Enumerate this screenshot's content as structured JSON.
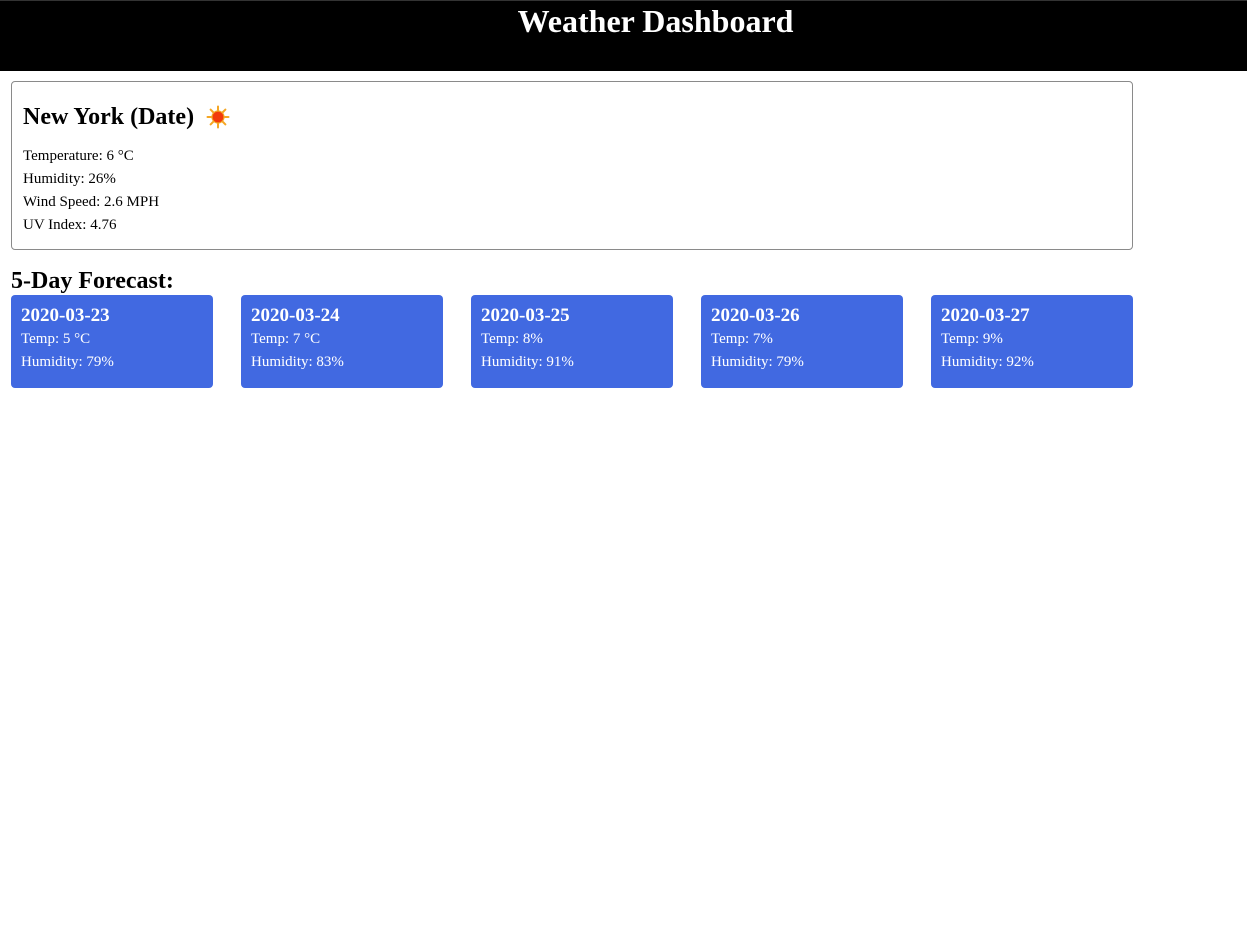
{
  "header": {
    "title": "Weather Dashboard"
  },
  "current": {
    "heading": "New York (Date)",
    "icon": "sun-icon",
    "temperature": "Temperature: 6 °C",
    "humidity": "Humidity: 26%",
    "wind_speed": "Wind Speed: 2.6 MPH",
    "uv_index": "UV Index: 4.76"
  },
  "forecast": {
    "title": "5-Day Forecast:",
    "card_color": "#4169e1",
    "days": [
      {
        "date": "2020-03-23",
        "temp": "Temp: 5 °C",
        "humidity": "Humidity: 79%"
      },
      {
        "date": "2020-03-24",
        "temp": "Temp: 7 °C",
        "humidity": "Humidity: 83%"
      },
      {
        "date": "2020-03-25",
        "temp": "Temp: 8%",
        "humidity": "Humidity: 91%"
      },
      {
        "date": "2020-03-26",
        "temp": "Temp: 7%",
        "humidity": "Humidity: 79%"
      },
      {
        "date": "2020-03-27",
        "temp": "Temp: 9%",
        "humidity": "Humidity: 92%"
      }
    ]
  }
}
